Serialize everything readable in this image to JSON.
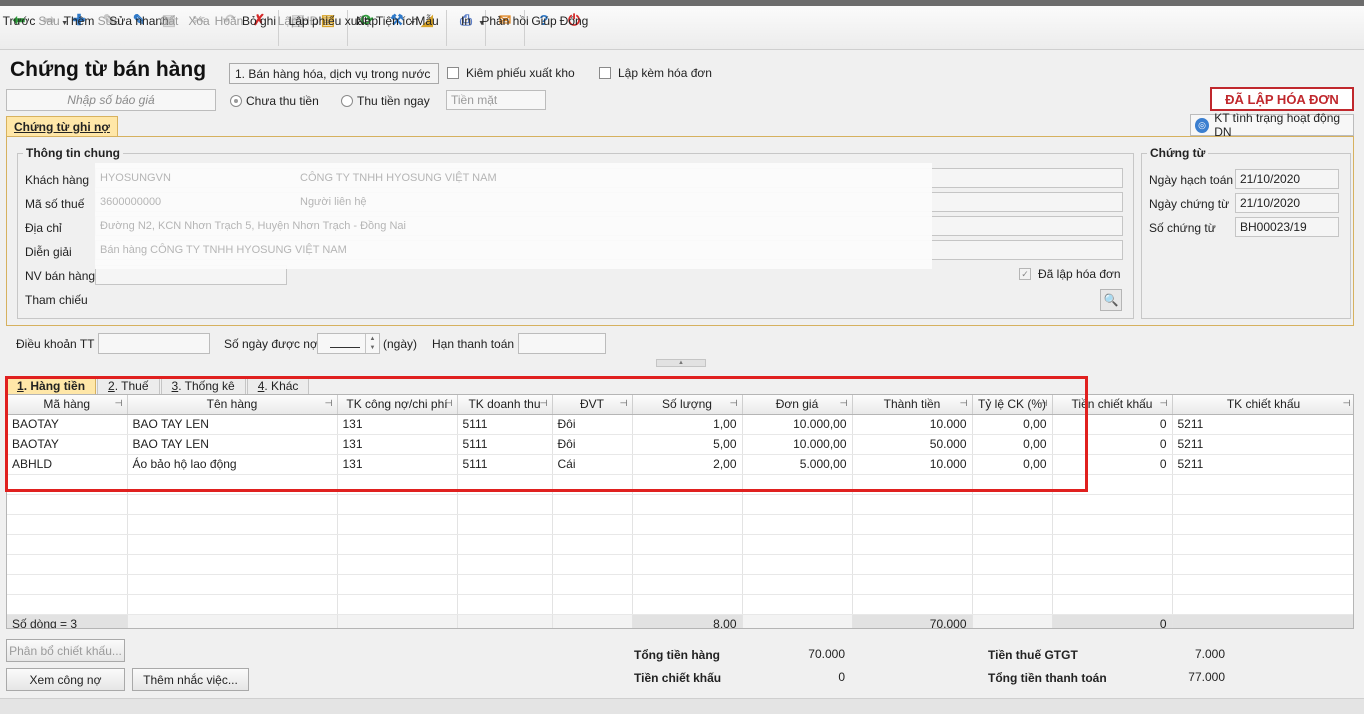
{
  "toolbar": {
    "buttons": [
      {
        "label": "Trước",
        "icon": "arrow-left-icon",
        "color": "#2e9a3a",
        "glyph": "⬅"
      },
      {
        "label": "Sau",
        "icon": "arrow-right-icon",
        "color": "#9a9a9a",
        "glyph": "➡"
      },
      {
        "label": "Thêm",
        "icon": "add-document-icon",
        "color": "#2f79c8",
        "glyph": "✚"
      },
      {
        "label": "Sửa",
        "icon": "edit-icon",
        "color": "#9a9a9a",
        "glyph": "✎"
      },
      {
        "label": "Sửa nhanh",
        "icon": "quick-edit-icon",
        "color": "#2f79c8",
        "glyph": "✎"
      },
      {
        "label": "Cất",
        "icon": "save-icon",
        "color": "#9a9a9a",
        "glyph": "▣"
      },
      {
        "label": "Xóa",
        "icon": "delete-icon",
        "color": "#9a9a9a",
        "glyph": "✂"
      },
      {
        "label": "Hoãn",
        "icon": "undo-icon",
        "color": "#9a9a9a",
        "glyph": "↶"
      },
      {
        "label": "Bỏ ghi",
        "icon": "unpost-icon",
        "color": "#d42a2a",
        "glyph": "✗"
      },
      {
        "label": "Lập HĐ",
        "icon": "create-invoice-icon",
        "color": "#9a9a9a",
        "glyph": "▤"
      },
      {
        "label": "Lập phiếu xuất",
        "icon": "create-issue-slip-icon",
        "color": "#d9a52a",
        "glyph": "▤"
      },
      {
        "label": "Nạp",
        "icon": "reload-icon",
        "color": "#2e9a3a",
        "glyph": "⟳"
      },
      {
        "label": "Tiện ích",
        "icon": "utilities-icon",
        "color": "#2f79c8",
        "glyph": "⚒"
      },
      {
        "label": "Mẫu",
        "icon": "template-icon",
        "color": "#d9a52a",
        "glyph": "◢"
      },
      {
        "label": "In",
        "icon": "print-icon",
        "color": "#5b7ec8",
        "glyph": "⎙"
      },
      {
        "label": "Phản hồi",
        "icon": "feedback-mail-icon",
        "color": "#e08a2a",
        "glyph": "✉"
      },
      {
        "label": "Giúp",
        "icon": "help-icon",
        "color": "#2f79c8",
        "glyph": "?"
      },
      {
        "label": "Đóng",
        "icon": "close-power-icon",
        "color": "#d42a2a",
        "glyph": "⏻"
      }
    ]
  },
  "header": {
    "title": "Chứng từ bán hàng",
    "sale_type": "1. Bán hàng hóa, dịch vụ trong nước",
    "check_export": "Kiêm phiếu xuất kho",
    "check_invoice": "Lập kèm hóa đơn",
    "quote_placeholder": "Nhập số báo giá",
    "radio_unpaid": "Chưa thu tiền",
    "radio_paid": "Thu tiền ngay",
    "payment_method": "Tiền mặt",
    "stamp": "ĐÃ LẬP HÓA ĐƠN"
  },
  "doc_tab": "Chứng từ ghi nợ",
  "kt_button": "KT tình trạng hoạt động DN",
  "general": {
    "title": "Thông tin chung",
    "labels": {
      "customer": "Khách hàng",
      "tax_code": "Mã số thuế",
      "address": "Địa chỉ",
      "description": "Diễn giải",
      "sales_staff": "NV bán hàng",
      "reference": "Tham chiếu"
    },
    "values": {
      "customer_code": "HYOSUNGVN",
      "customer_name": "CÔNG TY TNHH HYOSUNG VIỆT NAM",
      "tax_code": "3600000000",
      "contact": "Người liên hệ",
      "address": "Đường N2, KCN Nhơn Trạch 5, Huyện Nhơn Trạch - Đồng Nai",
      "description": "Bán hàng CÔNG TY TNHH HYOSUNG VIỆT NAM"
    },
    "invoiced_check": "Đã lập hóa đơn"
  },
  "voucher": {
    "title": "Chứng từ",
    "labels": {
      "posting_date": "Ngày hạch toán",
      "doc_date": "Ngày chứng từ",
      "doc_no": "Số chứng từ"
    },
    "values": {
      "posting_date": "21/10/2020",
      "doc_date": "21/10/2020",
      "doc_no": "BH00023/19"
    }
  },
  "terms": {
    "terms_label": "Điều khoản TT",
    "days_label": "Số ngày được nợ",
    "days_unit": "(ngày)",
    "due_label": "Hạn thanh toán"
  },
  "detail_tabs": [
    {
      "key": "1",
      "label": ". Hàng tiền"
    },
    {
      "key": "2",
      "label": ". Thuế"
    },
    {
      "key": "3",
      "label": ". Thống kê"
    },
    {
      "key": "4",
      "label": ". Khác"
    }
  ],
  "grid": {
    "columns": [
      "Mã hàng",
      "Tên hàng",
      "TK công nợ/chi phí",
      "TK doanh thu",
      "ĐVT",
      "Số lượng",
      "Đơn giá",
      "Thành tiền",
      "Tỷ lệ CK (%)",
      "Tiền chiết khấu",
      "TK chiết khấu"
    ],
    "rows": [
      [
        "BAOTAY",
        "BAO TAY LEN",
        "131",
        "5111",
        "Đôi",
        "1,00",
        "10.000,00",
        "10.000",
        "0,00",
        "0",
        "5211"
      ],
      [
        "BAOTAY",
        "BAO TAY LEN",
        "131",
        "5111",
        "Đôi",
        "5,00",
        "10.000,00",
        "50.000",
        "0,00",
        "0",
        "5211"
      ],
      [
        "ABHLD",
        "Áo bảo hộ lao động",
        "131",
        "5111",
        "Cái",
        "2,00",
        "5.000,00",
        "10.000",
        "0,00",
        "0",
        "5211"
      ]
    ],
    "totals": {
      "row_count": "Số dòng = 3",
      "quantity": "8,00",
      "amount": "70.000",
      "discount": "0"
    }
  },
  "buttons": {
    "allocate_discount": "Phân bổ chiết khấu...",
    "view_debt": "Xem công nợ",
    "add_reminder": "Thêm nhắc việc..."
  },
  "summary": {
    "total_goods_label": "Tổng tiền hàng",
    "total_goods": "70.000",
    "discount_label": "Tiền chiết khấu",
    "discount": "0",
    "vat_label": "Tiền thuế GTGT",
    "vat": "7.000",
    "total_pay_label": "Tổng tiền thanh toán",
    "total_pay": "77.000"
  }
}
